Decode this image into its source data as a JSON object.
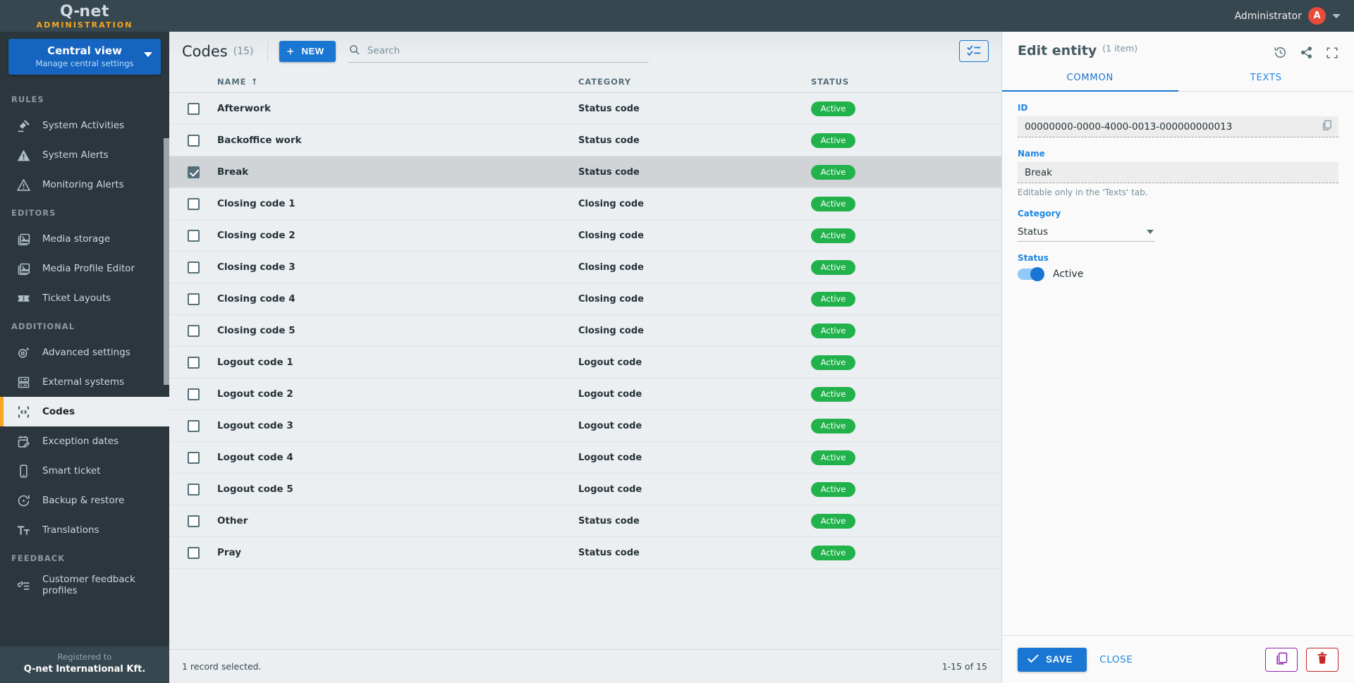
{
  "topbar": {
    "brand_main": "Q-net",
    "brand_sub": "ADMINISTRATION",
    "user_name": "Administrator",
    "avatar_initial": "A"
  },
  "sidebar": {
    "view_switch": {
      "title": "Central view",
      "subtitle": "Manage central settings"
    },
    "sections": [
      {
        "label": "RULES",
        "items": [
          {
            "label": "System Activities",
            "icon": "gavel-icon",
            "active": false
          },
          {
            "label": "System Alerts",
            "icon": "alert-filled-icon",
            "active": false
          },
          {
            "label": "Monitoring Alerts",
            "icon": "alert-outline-icon",
            "active": false
          }
        ]
      },
      {
        "label": "EDITORS",
        "items": [
          {
            "label": "Media storage",
            "icon": "image-icon",
            "active": false
          },
          {
            "label": "Media Profile Editor",
            "icon": "image-icon",
            "active": false
          },
          {
            "label": "Ticket Layouts",
            "icon": "ticket-icon",
            "active": false
          }
        ]
      },
      {
        "label": "ADDITIONAL",
        "items": [
          {
            "label": "Advanced settings",
            "icon": "gear-sparkle-icon",
            "active": false
          },
          {
            "label": "External systems",
            "icon": "server-icon",
            "active": false
          },
          {
            "label": "Codes",
            "icon": "code-brackets-icon",
            "active": true
          },
          {
            "label": "Exception dates",
            "icon": "calendar-edit-icon",
            "active": false
          },
          {
            "label": "Smart ticket",
            "icon": "phone-icon",
            "active": false
          },
          {
            "label": "Backup & restore",
            "icon": "restore-icon",
            "active": false
          },
          {
            "label": "Translations",
            "icon": "translate-icon",
            "active": false
          }
        ]
      },
      {
        "label": "FEEDBACK",
        "items": [
          {
            "label": "Customer feedback profiles",
            "icon": "feedback-icon",
            "active": false
          }
        ]
      }
    ],
    "footer": {
      "registered_label": "Registered to",
      "registered_name": "Q-net International Kft."
    }
  },
  "toolbar": {
    "page_title": "Codes",
    "page_count": "(15)",
    "new_label": "NEW",
    "search_placeholder": "Search",
    "search_value": "",
    "select_mode_icon": "checklist-icon"
  },
  "table": {
    "columns": [
      {
        "key": "name",
        "label": "NAME",
        "sorted": true,
        "sort_arrow": "↑"
      },
      {
        "key": "category",
        "label": "CATEGORY"
      },
      {
        "key": "status",
        "label": "STATUS"
      }
    ],
    "rows": [
      {
        "name": "Afterwork",
        "category": "Status code",
        "status": "Active",
        "checked": false
      },
      {
        "name": "Backoffice work",
        "category": "Status code",
        "status": "Active",
        "checked": false
      },
      {
        "name": "Break",
        "category": "Status code",
        "status": "Active",
        "checked": true
      },
      {
        "name": "Closing code 1",
        "category": "Closing code",
        "status": "Active",
        "checked": false
      },
      {
        "name": "Closing code 2",
        "category": "Closing code",
        "status": "Active",
        "checked": false
      },
      {
        "name": "Closing code 3",
        "category": "Closing code",
        "status": "Active",
        "checked": false
      },
      {
        "name": "Closing code 4",
        "category": "Closing code",
        "status": "Active",
        "checked": false
      },
      {
        "name": "Closing code 5",
        "category": "Closing code",
        "status": "Active",
        "checked": false
      },
      {
        "name": "Logout code 1",
        "category": "Logout code",
        "status": "Active",
        "checked": false
      },
      {
        "name": "Logout code 2",
        "category": "Logout code",
        "status": "Active",
        "checked": false
      },
      {
        "name": "Logout code 3",
        "category": "Logout code",
        "status": "Active",
        "checked": false
      },
      {
        "name": "Logout code 4",
        "category": "Logout code",
        "status": "Active",
        "checked": false
      },
      {
        "name": "Logout code 5",
        "category": "Logout code",
        "status": "Active",
        "checked": false
      },
      {
        "name": "Other",
        "category": "Status code",
        "status": "Active",
        "checked": false
      },
      {
        "name": "Pray",
        "category": "Status code",
        "status": "Active",
        "checked": false
      }
    ],
    "footer": {
      "selection_text": "1 record selected.",
      "range_text": "1-15 of 15"
    }
  },
  "panel": {
    "title": "Edit entity",
    "title_sub": "(1 item)",
    "head_icons": [
      {
        "name": "history-icon"
      },
      {
        "name": "share-icon"
      },
      {
        "name": "fullscreen-icon"
      }
    ],
    "tabs": [
      {
        "label": "COMMON",
        "active": true
      },
      {
        "label": "TEXTS",
        "active": false
      }
    ],
    "fields": {
      "id_label": "ID",
      "id_value": "00000000-0000-4000-0013-000000000013",
      "copy_icon": "copy-icon",
      "name_label": "Name",
      "name_value": "Break",
      "name_help": "Editable only in the 'Texts' tab.",
      "category_label": "Category",
      "category_value": "Status",
      "status_label": "Status",
      "status_toggle_label": "Active",
      "status_toggle_on": true
    },
    "footer": {
      "save_label": "SAVE",
      "close_label": "CLOSE",
      "duplicate_icon": "duplicate-icon",
      "delete_icon": "trash-icon"
    }
  },
  "colors": {
    "topbar_bg": "#37474f",
    "sidebar_bg": "#2b363d",
    "accent_blue": "#1976d2",
    "accent_orange": "#f5a623",
    "status_green": "#22b24c",
    "avatar_red": "#e74c3c",
    "delete_red": "#c62828",
    "duplicate_purple": "#8e24aa"
  }
}
